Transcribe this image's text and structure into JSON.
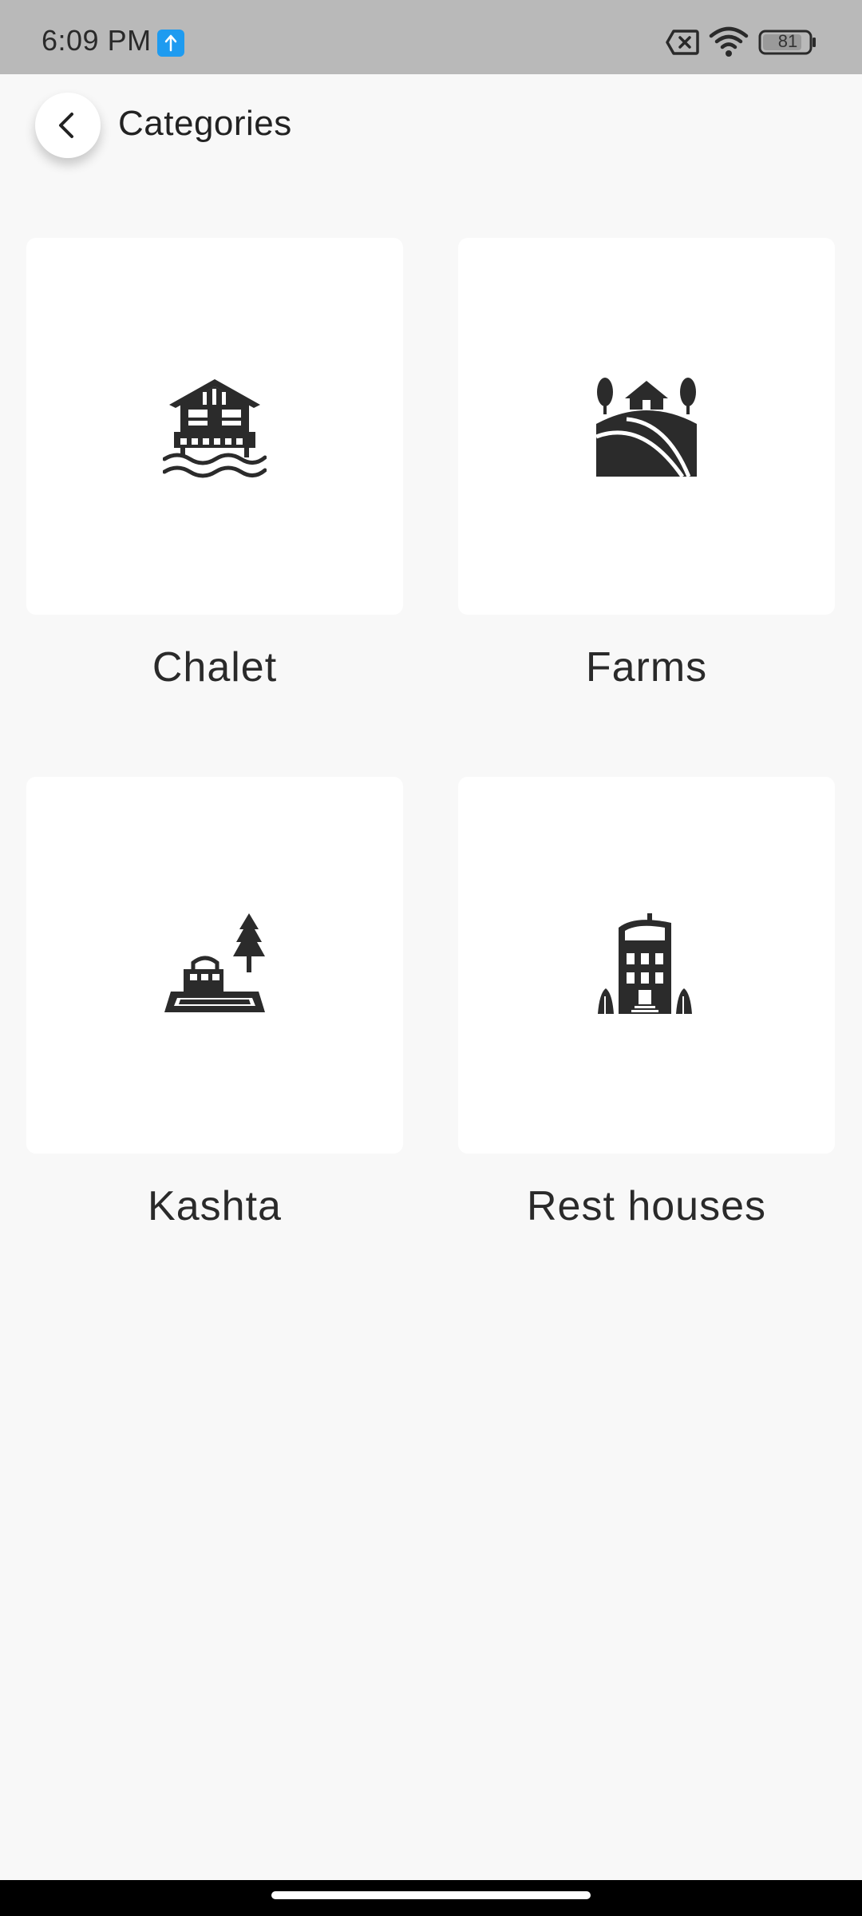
{
  "status_bar": {
    "time": "6:09 PM",
    "battery_level": "81",
    "icons": [
      "upload-icon",
      "sim-off-icon",
      "wifi-icon",
      "battery-icon"
    ]
  },
  "header": {
    "title": "Categories",
    "back_icon": "chevron-left-icon"
  },
  "categories": [
    {
      "label": "Chalet",
      "icon": "chalet-icon"
    },
    {
      "label": "Farms",
      "icon": "farm-icon"
    },
    {
      "label": "Kashta",
      "icon": "kashta-icon"
    },
    {
      "label": "Rest houses",
      "icon": "rest-house-icon"
    }
  ],
  "colors": {
    "background": "#f8f8f8",
    "card": "#ffffff",
    "status_bar": "#b9b9b9",
    "icon": "#2b2b2b",
    "accent": "#1e9bf0"
  }
}
